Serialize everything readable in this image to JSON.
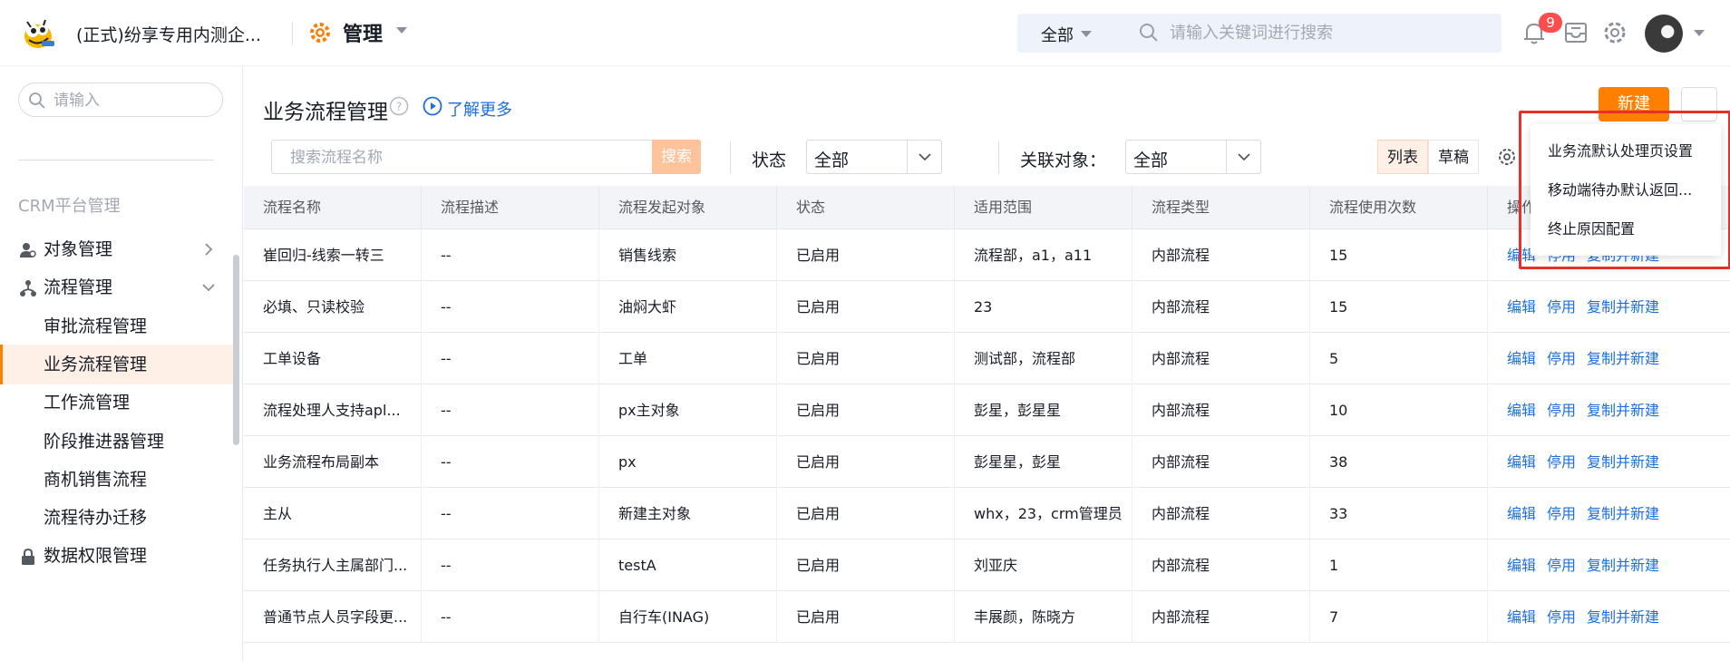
{
  "header": {
    "company": "(正式)纷享专用内测企...",
    "module": "管理",
    "search_scope": "全部",
    "search_placeholder": "请输入关键词进行搜索",
    "notification_count": "9"
  },
  "sidebar": {
    "search_placeholder": "请输入",
    "section_title": "CRM平台管理",
    "items": [
      {
        "label": "对象管理",
        "icon": "user-group-icon",
        "chevron": "chevron-right-icon"
      },
      {
        "label": "流程管理",
        "icon": "flow-icon",
        "chevron": "chevron-down-icon"
      },
      {
        "label": "审批流程管理"
      },
      {
        "label": "业务流程管理",
        "active": true
      },
      {
        "label": "工作流管理"
      },
      {
        "label": "阶段推进器管理"
      },
      {
        "label": "商机销售流程"
      },
      {
        "label": "流程待办迁移"
      },
      {
        "label": "数据权限管理",
        "icon": "lock-icon"
      }
    ]
  },
  "main": {
    "title": "业务流程管理",
    "learn_more": "了解更多",
    "new_button": "新建",
    "more_button": "...",
    "filter": {
      "name_placeholder": "搜索流程名称",
      "search_button": "搜索",
      "status_label": "状态",
      "status_value": "全部",
      "object_label": "关联对象：",
      "object_value": "全部"
    },
    "view_tabs": [
      "列表",
      "草稿"
    ],
    "table": {
      "columns": [
        "流程名称",
        "流程描述",
        "流程发起对象",
        "状态",
        "适用范围",
        "流程类型",
        "流程使用次数",
        "操作"
      ],
      "rows": [
        [
          "崔回归-线索一转三",
          "--",
          "销售线索",
          "已启用",
          "流程部，a1，a11",
          "内部流程",
          "15"
        ],
        [
          "必填、只读校验",
          "--",
          "油焖大虾",
          "已启用",
          "23",
          "内部流程",
          "15"
        ],
        [
          "工单设备",
          "--",
          "工单",
          "已启用",
          "测试部，流程部",
          "内部流程",
          "5"
        ],
        [
          "流程处理人支持apl...",
          "--",
          "px主对象",
          "已启用",
          "彭星，彭星星",
          "内部流程",
          "10"
        ],
        [
          "业务流程布局副本",
          "--",
          "px",
          "已启用",
          "彭星星，彭星",
          "内部流程",
          "38"
        ],
        [
          "主从",
          "--",
          "新建主对象",
          "已启用",
          "whx，23，crm管理员",
          "内部流程",
          "33"
        ],
        [
          "任务执行人主属部门...",
          "--",
          "testA",
          "已启用",
          "刘亚庆",
          "内部流程",
          "1"
        ],
        [
          "普通节点人员字段更...",
          "--",
          "自行车(INAG)",
          "已启用",
          "丰展颜，陈晓方",
          "内部流程",
          "7"
        ]
      ],
      "actions": [
        "编辑",
        "停用",
        "复制并新建"
      ]
    }
  },
  "dropdown": {
    "items": [
      "业务流默认处理页设置",
      "移动端待办默认返回...",
      "终止原因配置"
    ]
  },
  "colors": {
    "accent": "#ff8000",
    "link": "#1d6fe0",
    "highlight_border": "#e8302a",
    "badge": "#ff4d4f"
  }
}
